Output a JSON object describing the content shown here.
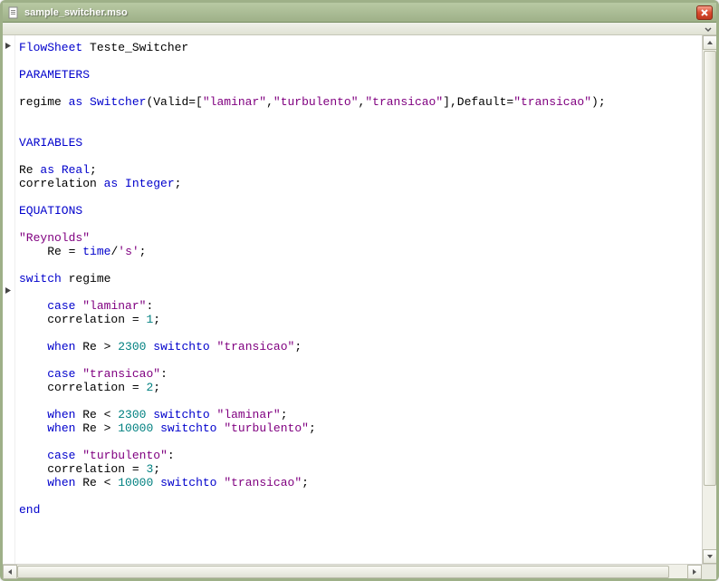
{
  "window": {
    "title": "sample_switcher.mso"
  },
  "code": {
    "l1": {
      "kw1": "FlowSheet",
      "name": " Teste_Switcher"
    },
    "l3": {
      "kw": "PARAMETERS"
    },
    "l5": {
      "var": "regime ",
      "kw_as": "as",
      "sp1": " ",
      "type": "Switcher",
      "open": "(Valid=[",
      "s1": "\"laminar\"",
      "c1": ",",
      "s2": "\"turbulento\"",
      "c2": ",",
      "s3": "\"transicao\"",
      "close": "],Default=",
      "s4": "\"transicao\"",
      "end": ");"
    },
    "l8": {
      "kw": "VARIABLES"
    },
    "l10": {
      "var": "Re ",
      "kw_as": "as",
      "sp": " ",
      "type": "Real",
      "end": ";"
    },
    "l11": {
      "var": "correlation ",
      "kw_as": "as",
      "sp": " ",
      "type": "Integer",
      "end": ";"
    },
    "l13": {
      "kw": "EQUATIONS"
    },
    "l15": {
      "s": "\"Reynolds\""
    },
    "l16": {
      "indent": "    ",
      "lhs": "Re = ",
      "kw": "time",
      "rhs": "/",
      "s": "'s'",
      "end": ";"
    },
    "l18": {
      "kw": "switch",
      "var": " regime"
    },
    "l20": {
      "indent": "    ",
      "kw": "case",
      "sp": " ",
      "s": "\"laminar\"",
      "end": ":"
    },
    "l21": {
      "indent": "    ",
      "lhs": "correlation = ",
      "num": "1",
      "end": ";"
    },
    "l23": {
      "indent": "    ",
      "kw1": "when",
      "cond": " Re > ",
      "num": "2300",
      "sp": " ",
      "kw2": "switchto",
      "sp2": " ",
      "s": "\"transicao\"",
      "end": ";"
    },
    "l25": {
      "indent": "    ",
      "kw": "case",
      "sp": " ",
      "s": "\"transicao\"",
      "end": ":"
    },
    "l26": {
      "indent": "    ",
      "lhs": "correlation = ",
      "num": "2",
      "end": ";"
    },
    "l28": {
      "indent": "    ",
      "kw1": "when",
      "cond": " Re < ",
      "num": "2300",
      "sp": " ",
      "kw2": "switchto",
      "sp2": " ",
      "s": "\"laminar\"",
      "end": ";"
    },
    "l29": {
      "indent": "    ",
      "kw1": "when",
      "cond": " Re > ",
      "num": "10000",
      "sp": " ",
      "kw2": "switchto",
      "sp2": " ",
      "s": "\"turbulento\"",
      "end": ";"
    },
    "l31": {
      "indent": "    ",
      "kw": "case",
      "sp": " ",
      "s": "\"turbulento\"",
      "end": ":"
    },
    "l32": {
      "indent": "    ",
      "lhs": "correlation = ",
      "num": "3",
      "end": ";"
    },
    "l33": {
      "indent": "    ",
      "kw1": "when",
      "cond": " Re < ",
      "num": "10000",
      "sp": " ",
      "kw2": "switchto",
      "sp2": " ",
      "s": "\"transicao\"",
      "end": ";"
    },
    "l35": {
      "kw": "end"
    }
  }
}
